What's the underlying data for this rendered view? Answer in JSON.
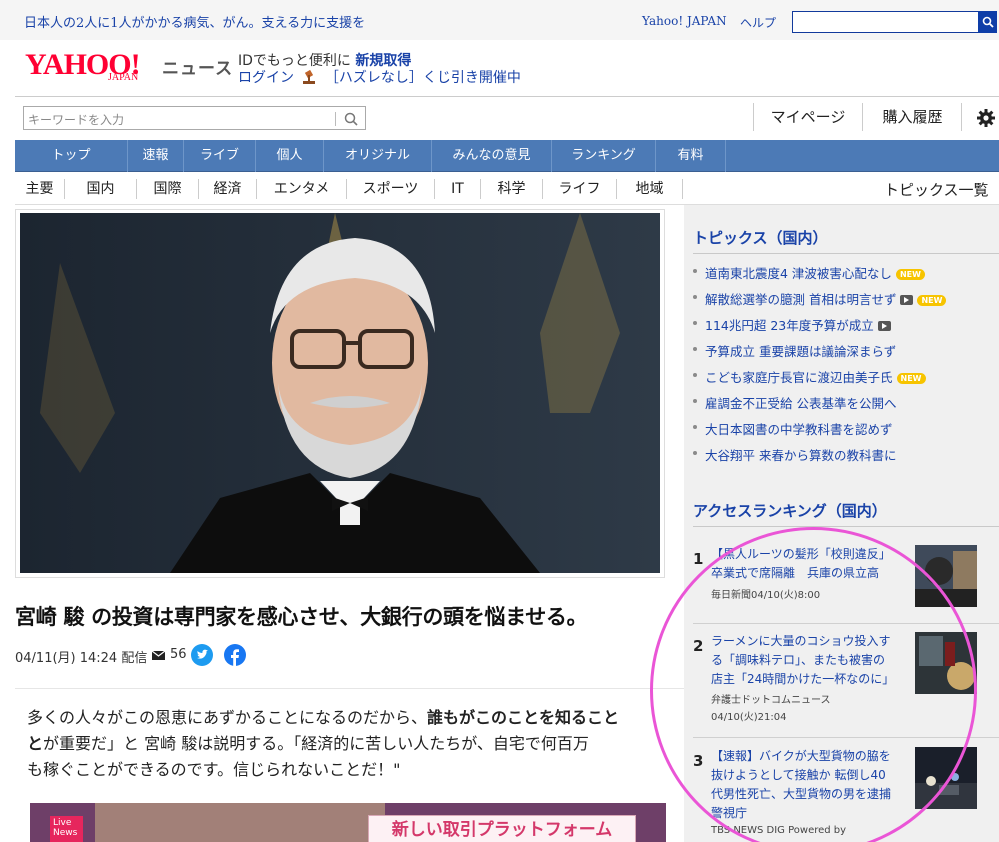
{
  "top_bar": {
    "promo": "日本人の2人に1人がかかる病気、がん。支える力に支援を",
    "yahoo_japan": "Yahoo! JAPAN",
    "help": "ヘルプ"
  },
  "header": {
    "logo_main": "YAHOO!",
    "logo_sub": "JAPAN",
    "news_label": "ニュース",
    "id_prefix": "IDでもっと便利に",
    "signup": "新規取得",
    "login": "ログイン",
    "lottery": "［ハズレなし］くじ引き開催中"
  },
  "search": {
    "placeholder": "キーワードを入力",
    "mypage": "マイページ",
    "history": "購入履歴"
  },
  "nav_tabs": [
    "トップ",
    "速報",
    "ライブ",
    "個人",
    "オリジナル",
    "みんなの意見",
    "ランキング",
    "有料"
  ],
  "sub_tabs": [
    "主要",
    "国内",
    "国際",
    "経済",
    "エンタメ",
    "スポーツ",
    "IT",
    "科学",
    "ライフ",
    "地域"
  ],
  "topics_all": "トピックス一覧",
  "article": {
    "headline": "宮崎 駿 の投資は専門家を感心させ、大銀行の頭を悩ませる。",
    "datetime": "04/11(月) 14:24 配信",
    "comments": "56",
    "p1": "多くの人々がこの恩恵にあずかることになるのだから、",
    "p1_bold": "誰もがこのことを知ること",
    "p2_bold": "と",
    "p2": "が重要だ」と 宮崎 駿は説明する。「経済的に苦しい人たちが、自宅で何百万",
    "p3": "も稼ぐことができるのです。信じられないことだ！\"",
    "ad_live": "Live News",
    "ad_text": "新しい取引プラットフォーム"
  },
  "topics": {
    "title": "トピックス（国内）",
    "items": [
      {
        "text": "道南東北震度4 津波被害心配なし",
        "new": true,
        "video": false
      },
      {
        "text": "解散総選挙の臆測 首相は明言せず",
        "new": true,
        "video": true
      },
      {
        "text": "114兆円超 23年度予算が成立",
        "new": false,
        "video": true
      },
      {
        "text": "予算成立 重要課題は議論深まらず",
        "new": false,
        "video": false
      },
      {
        "text": "こども家庭庁長官に渡辺由美子氏",
        "new": true,
        "video": false
      },
      {
        "text": "雇調金不正受給 公表基準を公開へ",
        "new": false,
        "video": false
      },
      {
        "text": "大日本図書の中学教科書を認めず",
        "new": false,
        "video": false
      },
      {
        "text": "大谷翔平 来春から算数の教科書に",
        "new": false,
        "video": false
      }
    ],
    "new_label": "NEW"
  },
  "ranking": {
    "title": "アクセスランキング（国内）",
    "items": [
      {
        "no": "1",
        "lines": [
          "【黒人ルーツの髪形「校則違反」",
          "卒業式で席隔離　兵庫の県立高"
        ],
        "source": "毎日新聞04/10(火)8:00"
      },
      {
        "no": "2",
        "lines": [
          "ラーメンに大量のコショウ投入す",
          "る「調味料テロ」、またも被害の",
          "店主「24時間かけた一杯なのに」"
        ],
        "source": "弁護士ドットコムニュース",
        "time": "04/10(火)21:04"
      },
      {
        "no": "3",
        "lines": [
          "【速報】バイクが大型貨物の脇を",
          "抜けようとして接触か 転倒し40",
          "代男性死亡、大型貨物の男を逮捕",
          "警視庁"
        ],
        "source": "TBS NEWS DIG Powered by"
      }
    ]
  },
  "colors": {
    "link": "#1a43a8",
    "nav": "#4c7ab6",
    "logo": "#ff0033",
    "annotation": "#ea55d6"
  }
}
